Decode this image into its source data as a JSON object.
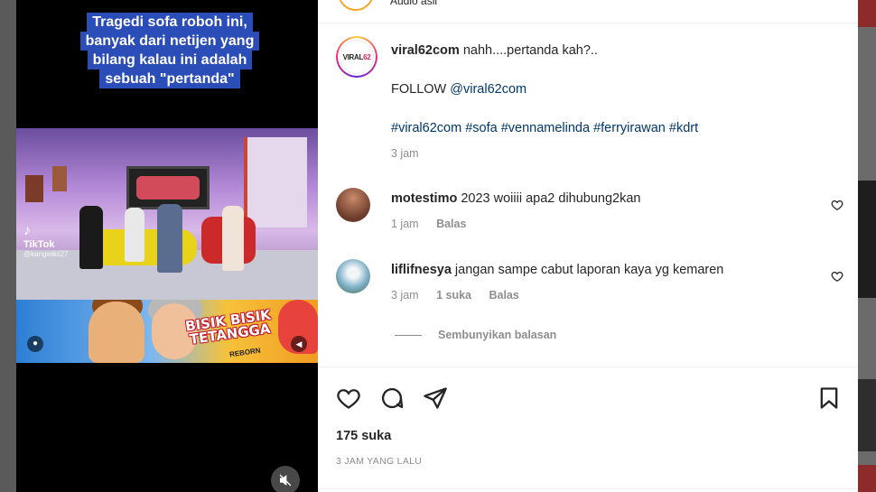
{
  "post": {
    "caption_overlay": [
      "Tragedi sofa roboh ini,",
      "banyak dari  netijen yang",
      "bilang kalau ini adalah",
      "sebuah \"pertanda\""
    ],
    "tiktok_label": "TikTok",
    "tiktok_handle": "@kangwikii27",
    "banner_text_line1": "BISIK BISIK",
    "banner_text_line2": "TETANGGA",
    "banner_sub": "REBORN",
    "author": "viral62com",
    "author_logo_text": "VIRAL",
    "author_logo_accent": "62",
    "caption": "nahh....pertanda kah?..",
    "follow_text": "FOLLOW",
    "follow_handle": "@viral62com",
    "hashtags": "#viral62com #sofa #vennamelinda #ferryirawan #kdrt",
    "caption_time": "3 jam",
    "like_count": "175 suka",
    "posted_ago": "3 JAM YANG LALU",
    "top_partial_text": "Audio asli"
  },
  "comments": [
    {
      "user": "motestimo",
      "text": "2023 woiiii apa2 dihubung2kan",
      "time": "1 jam",
      "reply": "Balas",
      "avatar_color": "#8a4a3a"
    },
    {
      "user": "liflifnesya",
      "text": "jangan sampe cabut laporan kaya yg kemaren",
      "time": "3 jam",
      "likes": "1 suka",
      "reply": "Balas",
      "avatar_color": "#6fa0b8"
    }
  ],
  "hide_replies_label": "Sembunyikan balasan",
  "colors": {
    "link": "#00376b",
    "muted": "#8e8e8e",
    "text": "#262626",
    "caption_bg": "#2b4db8"
  },
  "icons": [
    "heart-icon",
    "comment-icon",
    "share-icon",
    "bookmark-icon",
    "mute-icon"
  ]
}
